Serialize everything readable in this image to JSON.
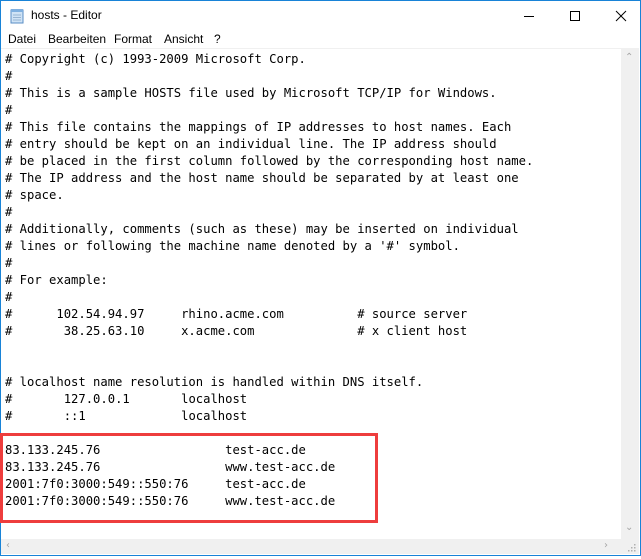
{
  "window": {
    "title": "hosts - Editor",
    "controls": {
      "minimize": "minimize",
      "maximize": "maximize",
      "close": "close"
    }
  },
  "menu": {
    "items": [
      {
        "label": "Datei"
      },
      {
        "label": "Bearbeiten"
      },
      {
        "label": "Format"
      },
      {
        "label": "Ansicht"
      },
      {
        "label": "?"
      }
    ]
  },
  "editor": {
    "lines": [
      "# Copyright (c) 1993-2009 Microsoft Corp.",
      "#",
      "# This is a sample HOSTS file used by Microsoft TCP/IP for Windows.",
      "#",
      "# This file contains the mappings of IP addresses to host names. Each",
      "# entry should be kept on an individual line. The IP address should",
      "# be placed in the first column followed by the corresponding host name.",
      "# The IP address and the host name should be separated by at least one",
      "# space.",
      "#",
      "# Additionally, comments (such as these) may be inserted on individual",
      "# lines or following the machine name denoted by a '#' symbol.",
      "#",
      "# For example:",
      "#",
      "#      102.54.94.97     rhino.acme.com          # source server",
      "#       38.25.63.10     x.acme.com              # x client host",
      "",
      "",
      "# localhost name resolution is handled within DNS itself.",
      "#\t127.0.0.1       localhost",
      "#\t::1             localhost",
      "",
      "83.133.245.76                 test-acc.de",
      "83.133.245.76                 www.test-acc.de",
      "2001:7f0:3000:549::550:76     test-acc.de",
      "2001:7f0:3000:549::550:76     www.test-acc.de"
    ]
  },
  "annotation": {
    "highlight_color": "#ee3d3d",
    "highlighted_lines": [
      23,
      24,
      25,
      26
    ]
  },
  "colors": {
    "window_border": "#1883d7",
    "scrollbar": "#f0f0f0"
  }
}
